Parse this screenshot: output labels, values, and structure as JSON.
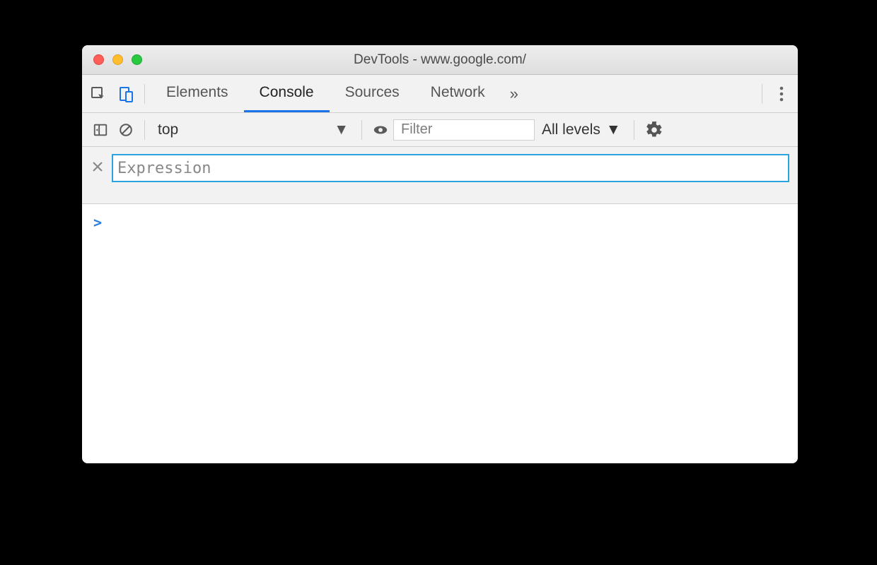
{
  "window": {
    "title": "DevTools - www.google.com/"
  },
  "tabs": {
    "items": [
      "Elements",
      "Console",
      "Sources",
      "Network"
    ],
    "active_index": 1
  },
  "console_toolbar": {
    "context": "top",
    "filter_placeholder": "Filter",
    "levels_label": "All levels"
  },
  "live_expression": {
    "placeholder": "Expression",
    "value": ""
  },
  "prompt": {
    "caret": ">"
  }
}
